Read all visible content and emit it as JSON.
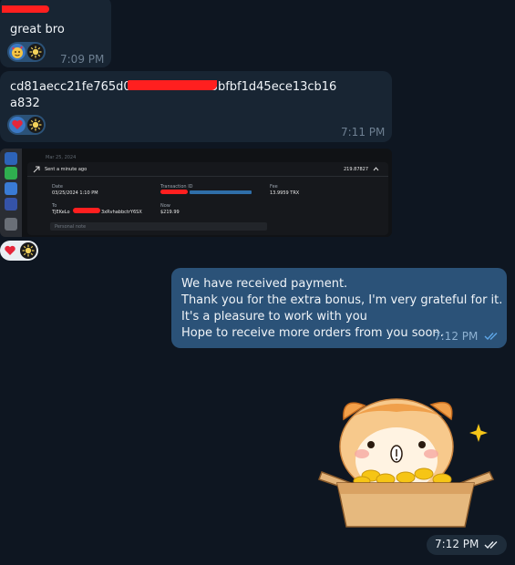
{
  "messages": {
    "m1": {
      "text": "great bro",
      "time": "7:09 PM"
    },
    "m2": {
      "text": "cd81aecc21fe765d0……4f093a3c3bfbf1d45ece13cb16\na832",
      "time": "7:11 PM"
    },
    "m4": {
      "text": "We have received payment.\nThank you for the extra bonus, I'm very grateful for it.\nIt's a pleasure to work with you\nHope to receive more orders from you soon.",
      "time": "7:12 PM"
    },
    "m5": {
      "time": "7:12 PM"
    }
  },
  "screenshot": {
    "date_header": "Mar 25, 2024",
    "status": "Sent a minute ago",
    "amount": "219.87827",
    "date_label": "Date",
    "date_value": "03/25/2024 1:10 PM",
    "txid_label": "Transaction ID",
    "fee_label": "Fee",
    "fee_value": "13.9959 TRX",
    "to_label": "To",
    "to_value_start": "TJEKeLo",
    "to_value_end": "3xRvhabbctrY6SX",
    "now_label": "Now",
    "now_value": "$219.99",
    "note_placeholder": "Personal note"
  },
  "reactions": {
    "m1": [
      "smiling-face-with-hearts",
      "custom-emoji"
    ],
    "m2": [
      "red-heart",
      "custom-emoji"
    ],
    "m3": [
      "red-heart",
      "custom-emoji"
    ]
  },
  "colors": {
    "background": "#0e1621",
    "incoming_bubble": "#182533",
    "outgoing_bubble": "#2b5278",
    "redaction": "#ff1f1f",
    "read_ticks": "#5ea7e8"
  }
}
